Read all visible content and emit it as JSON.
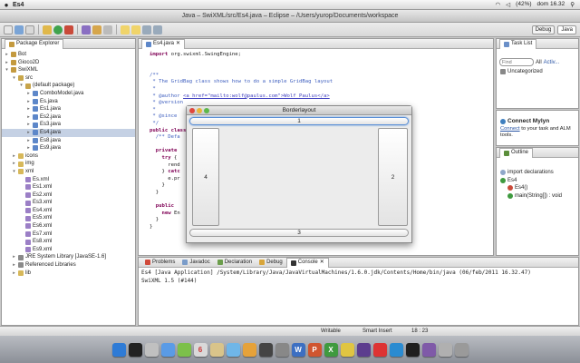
{
  "menubar": {
    "app_name": "Es4",
    "battery": "(42%)",
    "clock": "dom 16.32"
  },
  "window": {
    "title": "Java – SwiXML/src/Es4.java – Eclipse – /Users/yurop/Documents/workspace"
  },
  "toolbar": {
    "perspective_debug": "Debug",
    "perspective_java": "Java"
  },
  "package_explorer": {
    "tab_label": "Package Explorer",
    "items": [
      {
        "label": "Bot",
        "indent": 0,
        "twisty": "▸",
        "icon": "project-icon"
      },
      {
        "label": "Gioco2D",
        "indent": 0,
        "twisty": "▸",
        "icon": "project-icon"
      },
      {
        "label": "SwiXML",
        "indent": 0,
        "twisty": "▾",
        "icon": "project-icon"
      },
      {
        "label": "src",
        "indent": 1,
        "twisty": "▾",
        "icon": "source-folder-icon"
      },
      {
        "label": "(default package)",
        "indent": 2,
        "twisty": "▾",
        "icon": "package-icon"
      },
      {
        "label": "ComboModel.java",
        "indent": 3,
        "twisty": "▸",
        "icon": "java-file-icon"
      },
      {
        "label": "Es.java",
        "indent": 3,
        "twisty": "▸",
        "icon": "java-file-icon"
      },
      {
        "label": "Es1.java",
        "indent": 3,
        "twisty": "▸",
        "icon": "java-file-icon"
      },
      {
        "label": "Es2.java",
        "indent": 3,
        "twisty": "▸",
        "icon": "java-file-icon"
      },
      {
        "label": "Es3.java",
        "indent": 3,
        "twisty": "▸",
        "icon": "java-file-icon"
      },
      {
        "label": "Es4.java",
        "indent": 3,
        "twisty": "▸",
        "icon": "java-file-icon",
        "selected": true
      },
      {
        "label": "Es8.java",
        "indent": 3,
        "twisty": "▸",
        "icon": "java-file-icon"
      },
      {
        "label": "Es9.java",
        "indent": 3,
        "twisty": "▸",
        "icon": "java-file-icon"
      },
      {
        "label": "icons",
        "indent": 1,
        "twisty": "▸",
        "icon": "folder-icon"
      },
      {
        "label": "img",
        "indent": 1,
        "twisty": "▸",
        "icon": "folder-icon"
      },
      {
        "label": "xml",
        "indent": 1,
        "twisty": "▾",
        "icon": "folder-icon"
      },
      {
        "label": "Es.xml",
        "indent": 2,
        "twisty": "",
        "icon": "xml-file-icon"
      },
      {
        "label": "Es1.xml",
        "indent": 2,
        "twisty": "",
        "icon": "xml-file-icon"
      },
      {
        "label": "Es2.xml",
        "indent": 2,
        "twisty": "",
        "icon": "xml-file-icon"
      },
      {
        "label": "Es3.xml",
        "indent": 2,
        "twisty": "",
        "icon": "xml-file-icon"
      },
      {
        "label": "Es4.xml",
        "indent": 2,
        "twisty": "",
        "icon": "xml-file-icon"
      },
      {
        "label": "Es5.xml",
        "indent": 2,
        "twisty": "",
        "icon": "xml-file-icon"
      },
      {
        "label": "Es6.xml",
        "indent": 2,
        "twisty": "",
        "icon": "xml-file-icon"
      },
      {
        "label": "Es7.xml",
        "indent": 2,
        "twisty": "",
        "icon": "xml-file-icon"
      },
      {
        "label": "Es8.xml",
        "indent": 2,
        "twisty": "",
        "icon": "xml-file-icon"
      },
      {
        "label": "Es9.xml",
        "indent": 2,
        "twisty": "",
        "icon": "xml-file-icon"
      },
      {
        "label": "JRE System Library [JavaSE-1.6]",
        "indent": 1,
        "twisty": "▸",
        "icon": "library-icon"
      },
      {
        "label": "Referenced Libraries",
        "indent": 1,
        "twisty": "▸",
        "icon": "library-icon"
      },
      {
        "label": "lib",
        "indent": 1,
        "twisty": "▸",
        "icon": "folder-icon"
      }
    ]
  },
  "editor": {
    "tab_label": "Es4.java",
    "lines": [
      [
        [
          "kw",
          "import "
        ],
        [
          "",
          "org.swixml.SwingEngine;"
        ]
      ],
      [
        [
          "",
          ""
        ]
      ],
      [
        [
          "",
          ""
        ]
      ],
      [
        [
          "jd",
          "/**"
        ]
      ],
      [
        [
          "jd",
          " * The GridBag class shows how to do a simple GridBag layout"
        ]
      ],
      [
        [
          "jd",
          " *"
        ]
      ],
      [
        [
          "jd",
          " * @author "
        ],
        [
          "lk",
          "<a href=\"mailto:wolf@paulus.com\">Wolf Paulus</a>"
        ]
      ],
      [
        [
          "jd",
          " * @version"
        ]
      ],
      [
        [
          "jd",
          " *"
        ]
      ],
      [
        [
          "jd",
          " * @since"
        ]
      ],
      [
        [
          "jd",
          " */"
        ]
      ],
      [
        [
          "kw",
          "public "
        ],
        [
          "kw",
          "class "
        ]
      ],
      [
        [
          "jd",
          "  /** Defa"
        ]
      ],
      [
        [
          "",
          ""
        ]
      ],
      [
        [
          "kw",
          "  private"
        ]
      ],
      [
        [
          "kw",
          "    try "
        ],
        [
          "",
          "{"
        ]
      ],
      [
        [
          "",
          "      rend"
        ]
      ],
      [
        [
          "",
          "    } "
        ],
        [
          "kw",
          "catc"
        ]
      ],
      [
        [
          "",
          "      e.pr"
        ]
      ],
      [
        [
          "",
          "    }"
        ]
      ],
      [
        [
          "",
          "  }"
        ]
      ],
      [
        [
          "",
          ""
        ]
      ],
      [
        [
          "kw",
          "  public "
        ]
      ],
      [
        [
          "kw",
          "    new "
        ],
        [
          "",
          "En"
        ]
      ],
      [
        [
          "",
          "  }"
        ]
      ],
      [
        [
          "",
          "}"
        ]
      ]
    ]
  },
  "swing_window": {
    "title": "Borderlayout",
    "north": "1",
    "east": "2",
    "south": "3",
    "west": "4"
  },
  "task_list": {
    "tab_label": "Task List",
    "find_placeholder": "Find",
    "all": "All",
    "activate": "Activ...",
    "uncategorized": "Uncategorized"
  },
  "mylyn": {
    "title": "Connect Mylyn",
    "link": "Connect",
    "text": "to your task and ALM tools."
  },
  "outline": {
    "tab_label": "Outline",
    "items": [
      {
        "label": "import declarations",
        "indent": 0,
        "icon": "imports-icon"
      },
      {
        "label": "Es4",
        "indent": 0,
        "icon": "class-icon"
      },
      {
        "label": "Es4()",
        "indent": 1,
        "icon": "constructor-icon"
      },
      {
        "label": "main(String[]) : void",
        "indent": 1,
        "icon": "method-icon"
      }
    ]
  },
  "bottom_tabs": {
    "problems": "Problems",
    "javadoc": "Javadoc",
    "declaration": "Declaration",
    "debug": "Debug",
    "console": "Console"
  },
  "console": {
    "header": "Es4 [Java Application] /System/Library/Java/JavaVirtualMachines/1.6.0.jdk/Contents/Home/bin/java (06/feb/2011 16.32.47)",
    "output": "SwiXML 1.5 (#144)"
  },
  "statusbar": {
    "writable": "Writable",
    "insert_mode": "Smart Insert",
    "position": "18 : 23"
  },
  "colors": {
    "accent": "#3875d7",
    "selection": "#c5d1e4"
  }
}
